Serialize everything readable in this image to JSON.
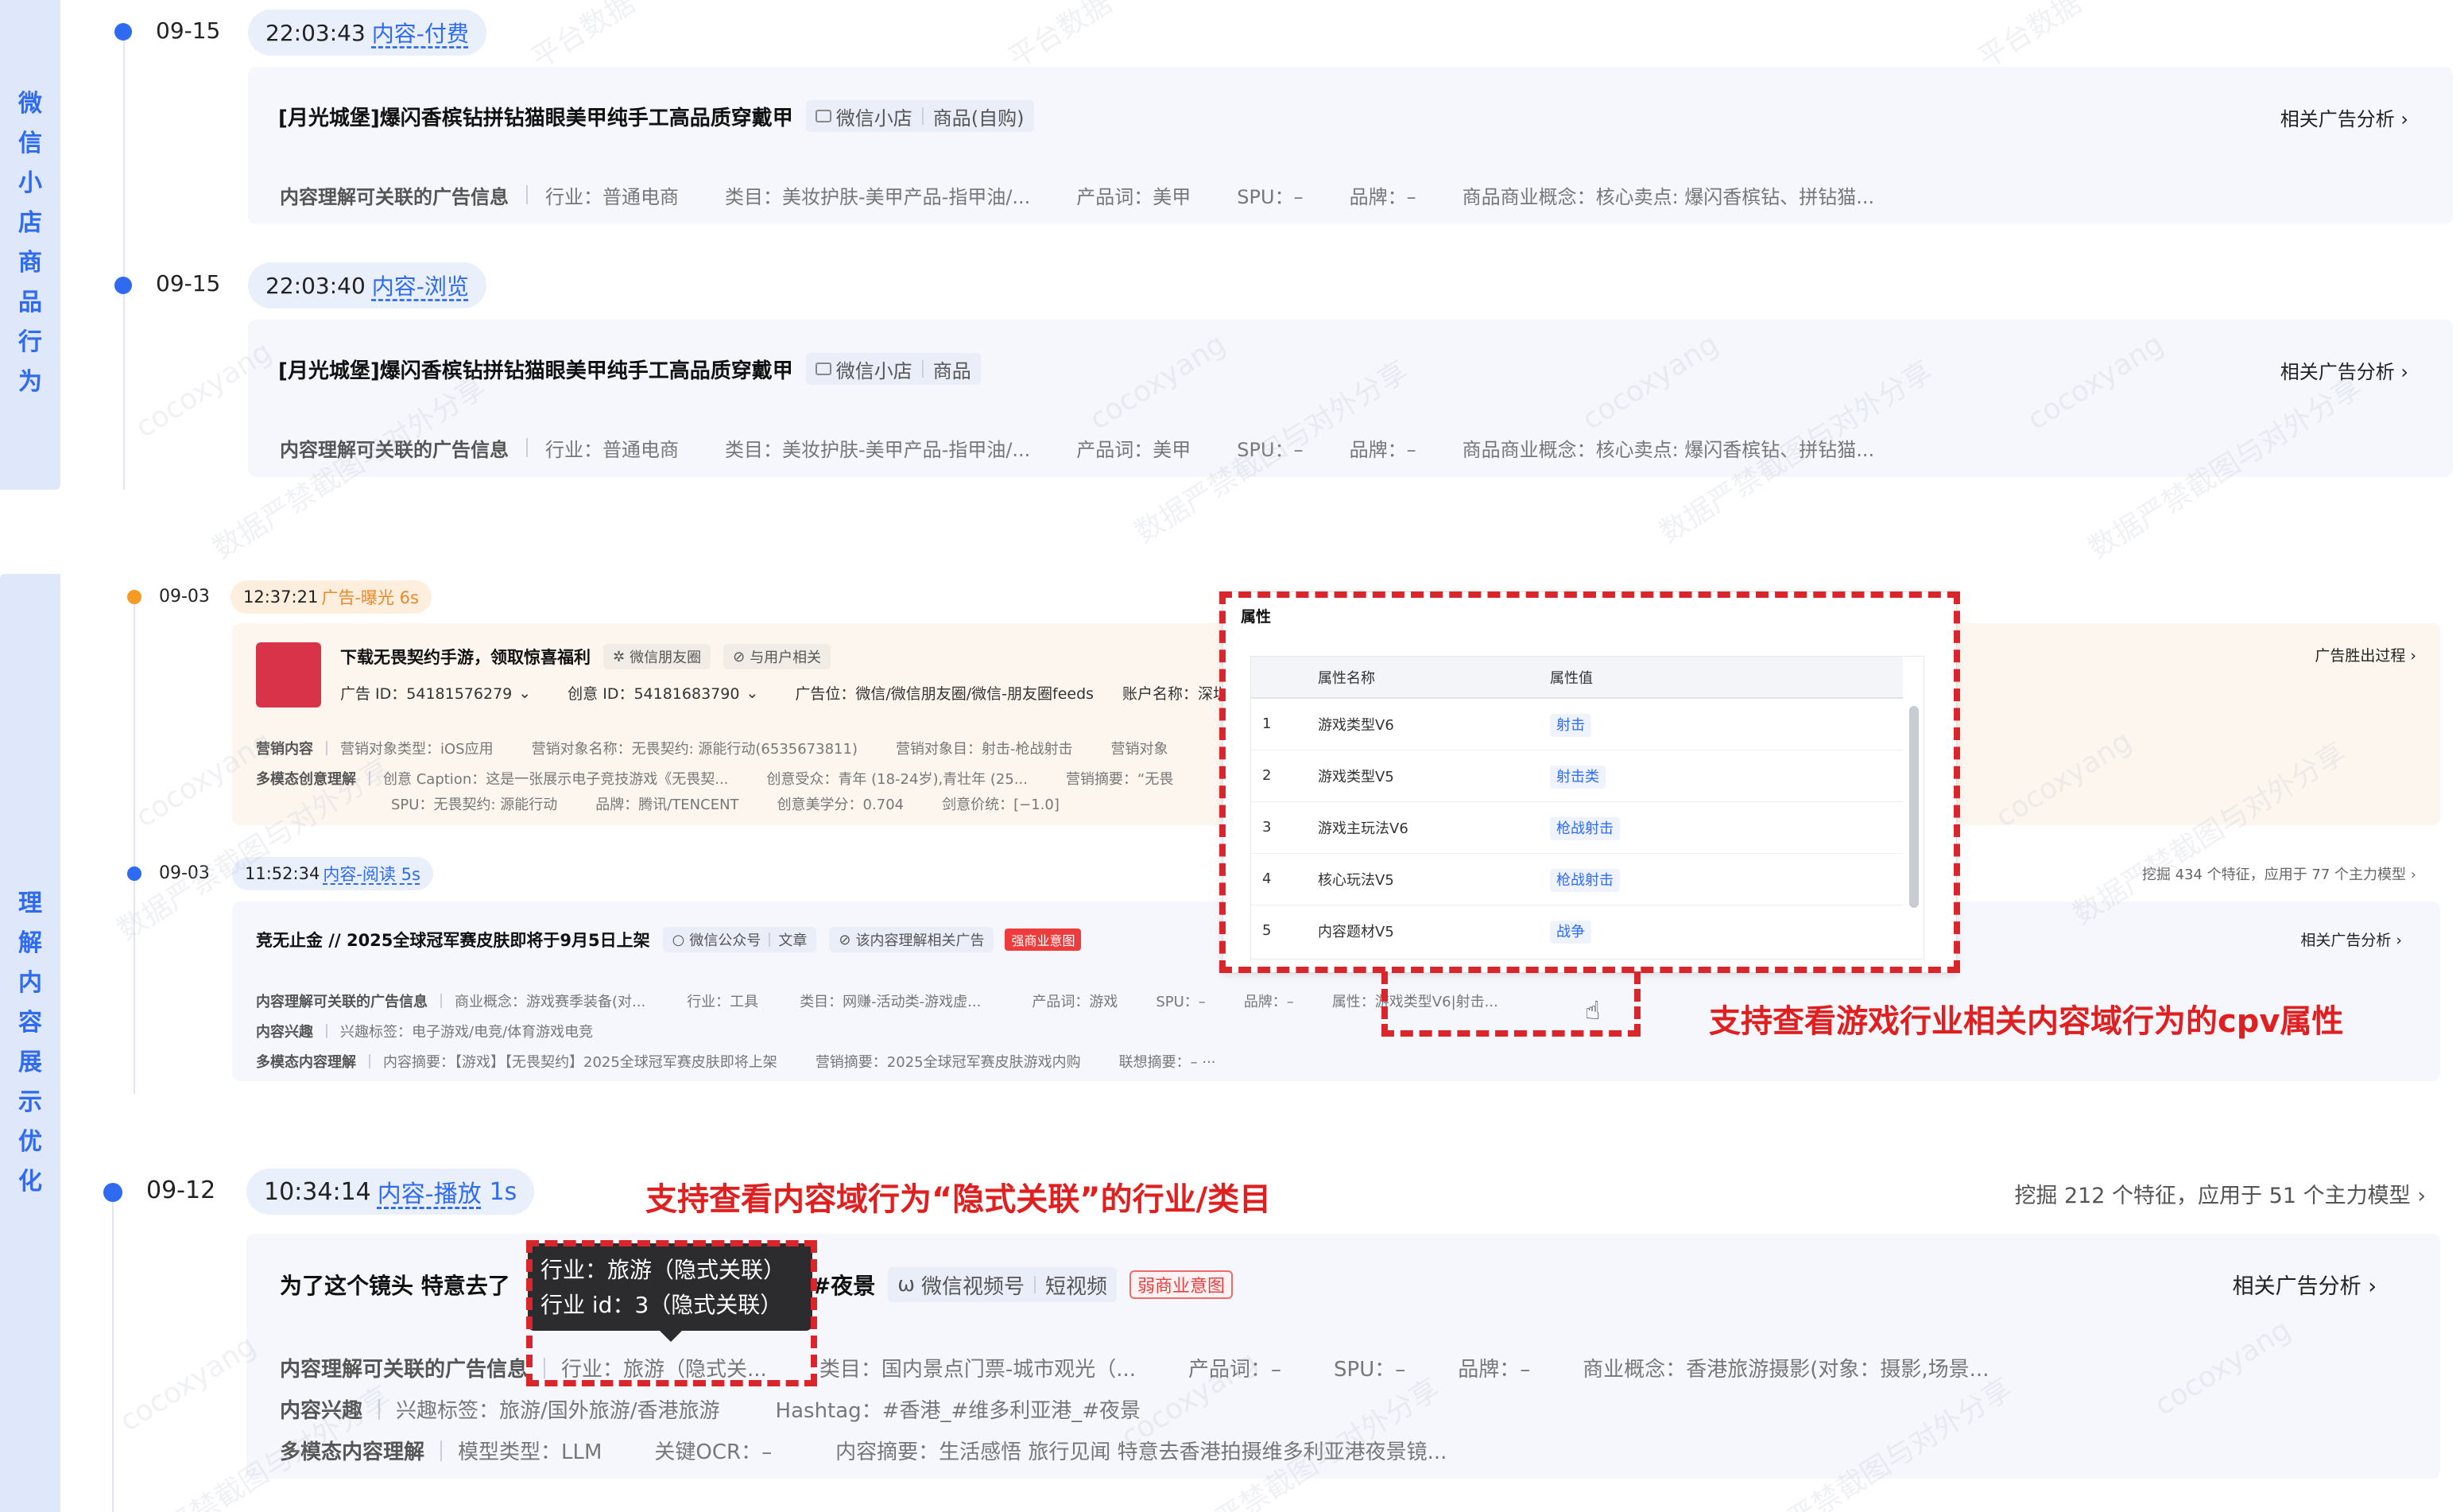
{
  "section1": {
    "label": [
      "微",
      "信",
      "小",
      "店",
      "商",
      "品",
      "行",
      "为"
    ],
    "events": [
      {
        "date": "09-15",
        "time": "22:03:43",
        "action": "内容-付费",
        "title": "[月光城堡]爆闪香槟钻拼钻猫眼美甲纯手工高品质穿戴甲",
        "tag_a": "微信小店",
        "tag_b": "商品(自购)",
        "link": "相关广告分析",
        "row_head": "内容理解可关联的广告信息",
        "fields": [
          "行业：普通电商",
          "类目：美妆护肤-美甲产品-指甲油/...",
          "产品词：美甲",
          "SPU：–",
          "品牌：–",
          "商品商业概念：核心卖点: 爆闪香槟钻、拼钻猫..."
        ]
      },
      {
        "date": "09-15",
        "time": "22:03:40",
        "action": "内容-浏览",
        "title": "[月光城堡]爆闪香槟钻拼钻猫眼美甲纯手工高品质穿戴甲",
        "tag_a": "微信小店",
        "tag_b": "商品",
        "link": "相关广告分析",
        "row_head": "内容理解可关联的广告信息",
        "fields": [
          "行业：普通电商",
          "类目：美妆护肤-美甲产品-指甲油/...",
          "产品词：美甲",
          "SPU：–",
          "品牌：–",
          "商品商业概念：核心卖点: 爆闪香槟钻、拼钻猫..."
        ]
      }
    ]
  },
  "section2": {
    "label": [
      "理",
      "解",
      "内",
      "容",
      "展",
      "示",
      "优",
      "化"
    ],
    "ad_event": {
      "date": "09-03",
      "time": "12:37:21",
      "action": "广告-曝光 6s",
      "title": "下载无畏契约手游，领取惊喜福利",
      "tag_a": "微信朋友圈",
      "tag_b": "与用户相关",
      "ad_id": "广告 ID：54181576279",
      "creative_id": "创意 ID：54181683790",
      "position": "广告位：微信/微信朋友圈/微信-朋友圈feeds",
      "account": "账户名称：深圳市腾",
      "link": "广告胜出过程",
      "r1_head": "营销内容",
      "r1_fields": [
        "营销对象类型：iOS应用",
        "营销对象名称：无畏契约: 源能行动(6535673811)",
        "营销对象目：射击-枪战射击",
        "营销对象"
      ],
      "r2_head": "多模态创意理解",
      "r2_fields": [
        "创意 Caption：这是一张展示电子竞技游戏《无畏契...",
        "创意受众：青年 (18-24岁),青壮年 (25...",
        "营销摘要：“无畏"
      ],
      "r3_fields": [
        "SPU：无畏契约: 源能行动",
        "品牌：腾讯/TENCENT",
        "创意美学分：0.704",
        "剑意价统：[−1.0]"
      ]
    },
    "read_event": {
      "date": "09-03",
      "time": "11:52:34",
      "action": "内容-阅读 5s",
      "link_top": "挖掘 434 个特征，应用于 77 个主力模型",
      "title": "竞无止金 // 2025全球冠军赛皮肤即将于9月5日上架",
      "tag_a": "微信公众号",
      "tag_b": "文章",
      "tag_c": "该内容理解相关广告",
      "red_tag": "强商业意图",
      "link": "相关广告分析",
      "r1_head": "内容理解可关联的广告信息",
      "r1_fields": [
        "商业概念：游戏赛季装备(对...",
        "行业：工具",
        "类目：网赚-活动类-游戏虚...",
        "产品词：游戏",
        "SPU：–",
        "品牌：–",
        "属性：游戏类型V6|射击..."
      ],
      "r2_head": "内容兴趣",
      "r2_fields": [
        "兴趣标签：电子游戏/电竞/体育游戏电竞"
      ],
      "r3_head": "多模态内容理解",
      "r3_fields": [
        "内容摘要：【游戏】【无畏契约】2025全球冠军赛皮肤即将上架",
        "营销摘要：2025全球冠军赛皮肤游戏内购",
        "联想摘要：– ···"
      ]
    },
    "popup": {
      "title": "属性",
      "col_name": "属性名称",
      "col_value": "属性值",
      "rows": [
        {
          "idx": "1",
          "name": "游戏类型V6",
          "value": "射击"
        },
        {
          "idx": "2",
          "name": "游戏类型V5",
          "value": "射击类"
        },
        {
          "idx": "3",
          "name": "游戏主玩法V6",
          "value": "枪战射击"
        },
        {
          "idx": "4",
          "name": "核心玩法V5",
          "value": "枪战射击"
        },
        {
          "idx": "5",
          "name": "内容题材V5",
          "value": "战争"
        }
      ]
    },
    "note1": "支持查看游戏行业相关内容域行为的cpv属性",
    "play_event": {
      "date": "09-12",
      "time": "10:34:14",
      "action": "内容-播放",
      "duration": "1s",
      "note2": "支持查看内容域行为“隐式关联”的行业/类目",
      "link_top": "挖掘 212 个特征，应用于 51 个主力模型",
      "title_a": "为了这个镜头 特意去了",
      "title_b": "港#夜景",
      "tag_a": "微信视频号",
      "tag_b": "短视频",
      "red_tag": "弱商业意图",
      "link": "相关广告分析",
      "tooltip_l1": "行业：旅游（隐式关联）",
      "tooltip_l2": "行业 id：3（隐式关联）",
      "r1_head": "内容理解可关联的广告信息",
      "r1_fields": [
        "行业：旅游（隐式关...",
        "类目：国内景点门票-城市观光（...",
        "产品词：–",
        "SPU：–",
        "品牌：–",
        "商业概念：香港旅游摄影(对象：摄影,场景..."
      ],
      "r2_head": "内容兴趣",
      "r2_fields": [
        "兴趣标签：旅游/国外旅游/香港旅游",
        "Hashtag：#香港_#维多利亚港_#夜景"
      ],
      "r3_head": "多模态内容理解",
      "r3_fields": [
        "模型类型：LLM",
        "关键OCR：–",
        "内容摘要：生活感悟 旅行见闻 特意去香港拍摄维多利亚港夜景镜..."
      ]
    }
  },
  "watermarks": [
    "cocoxyang",
    "数据严禁截图与对外分享",
    "平台数据"
  ]
}
